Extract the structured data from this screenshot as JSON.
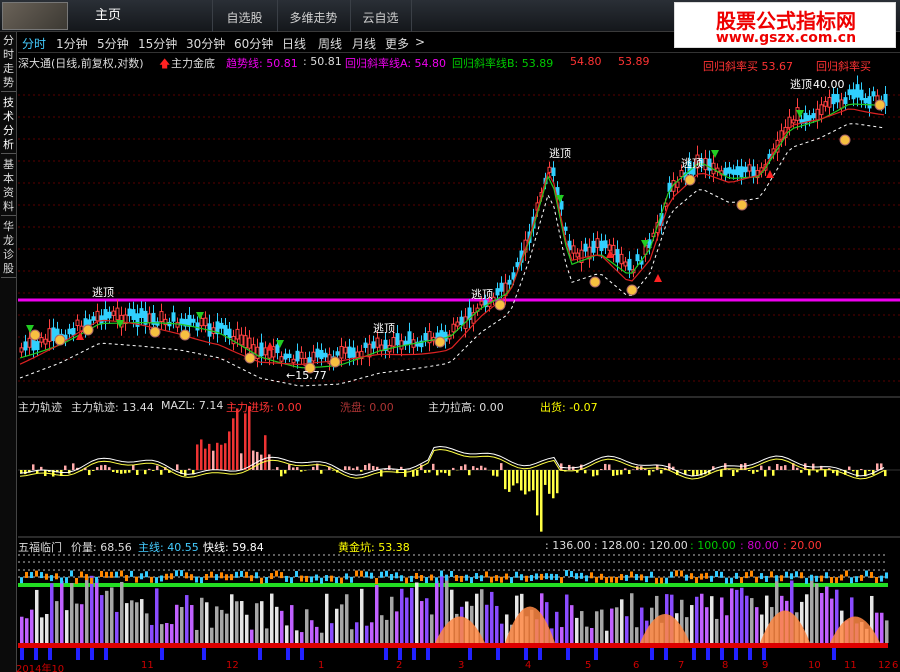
{
  "toolbar": {
    "home": "主页",
    "tabs": [
      "自选股",
      "多维走势",
      "云自选"
    ]
  },
  "brand": {
    "title": "股票公式指标网",
    "url": "www.gszx.com.cn"
  },
  "sidebar": {
    "tabs": [
      "分时走势",
      "技术分析",
      "基本资料",
      "华龙诊股"
    ]
  },
  "periods": [
    "分时",
    "1分钟",
    "5分钟",
    "15分钟",
    "30分钟",
    "60分钟",
    "日线",
    "周线",
    "月线",
    "更多"
  ],
  "main": {
    "symbol": "深大通(日线,前复权,对数)",
    "formula": "主力金底",
    "trend_label": "趋势线: 50.81",
    "trend_value": ": 50.81",
    "regA_label": "回归斜率线A: 54.80",
    "regB_label": "回归斜率线B: 53.89",
    "v1": "54.80",
    "v2": "53.89",
    "corner_left": "回归斜率买 53.67",
    "corner_right": "回归斜率买",
    "top_price": "40.00",
    "low_price": "←15.77",
    "escape_label": "逃顶"
  },
  "ind1": {
    "title": "主力轨迹",
    "gj": "主力轨迹: 13.44",
    "mazl": "MAZL: 7.14",
    "jinchang": "主力进场: 0.00",
    "xipan": "洗盘: 0.00",
    "lagao": "主力拉高: 0.00",
    "chuhuo": "出货: -0.07"
  },
  "ind2": {
    "title": "五福临门",
    "jialiang": "价量: 68.56",
    "zhuxian": "主线: 40.55",
    "kuaixian": "快线: 59.84",
    "huangjin": "黄金坑: 53.38",
    "levels": [
      ": 136.00",
      ": 128.00",
      ": 120.00",
      ": 100.00",
      ": 80.00",
      ": 20.00"
    ]
  },
  "dates": [
    "2014年10",
    "11",
    "12",
    "1",
    "2",
    "3",
    "4",
    "5",
    "6",
    "7",
    "8",
    "9",
    "10",
    "11",
    "12",
    "6"
  ],
  "colors": {
    "accent": "#e0e",
    "up": "#f33",
    "down": "#3cf",
    "ma_green": "#3c3",
    "ma_red": "#d22",
    "yellow": "#ff0"
  },
  "chart_data": [
    {
      "type": "candlestick",
      "title": "深大通(日线,前复权,对数)",
      "series": [
        {
          "name": "趋势线",
          "values": [
            50.81
          ]
        },
        {
          "name": "回归斜率线A",
          "values": [
            54.8
          ]
        },
        {
          "name": "回归斜率线B",
          "values": [
            53.89
          ]
        }
      ],
      "annotations": [
        "逃顶",
        "←15.77",
        "40.00"
      ]
    },
    {
      "type": "bar",
      "title": "主力轨迹",
      "series": [
        {
          "name": "主力轨迹",
          "values": [
            13.44
          ]
        },
        {
          "name": "MAZL",
          "values": [
            7.14
          ]
        },
        {
          "name": "主力进场",
          "values": [
            0.0
          ]
        },
        {
          "name": "洗盘",
          "values": [
            0.0
          ]
        },
        {
          "name": "主力拉高",
          "values": [
            0.0
          ]
        },
        {
          "name": "出货",
          "values": [
            -0.07
          ]
        }
      ]
    },
    {
      "type": "area",
      "title": "五福临门",
      "series": [
        {
          "name": "价量",
          "values": [
            68.56
          ]
        },
        {
          "name": "主线",
          "values": [
            40.55
          ]
        },
        {
          "name": "快线",
          "values": [
            59.84
          ]
        },
        {
          "name": "黄金坑",
          "values": [
            53.38
          ]
        }
      ],
      "ylim": [
        20,
        136
      ]
    }
  ]
}
